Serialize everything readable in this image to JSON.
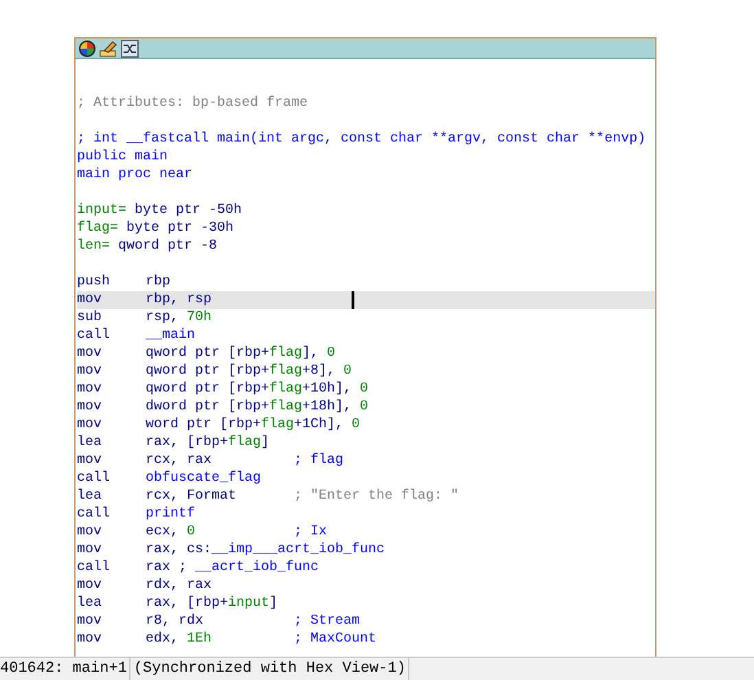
{
  "blocks": [
    [
      {
        "kind": "text",
        "segments": [
          {
            "text": "; Attributes: bp-based frame",
            "kind": "cmt"
          }
        ]
      }
    ],
    [
      {
        "kind": "text",
        "segments": [
          {
            "text": "; int __fastcall main(int argc, const char **argv, const char **envp)",
            "kind": "name"
          }
        ]
      },
      {
        "kind": "text",
        "segments": [
          {
            "text": "public main",
            "kind": "name"
          }
        ]
      },
      {
        "kind": "text",
        "segments": [
          {
            "text": "main proc near",
            "kind": "name"
          }
        ]
      }
    ],
    [
      {
        "kind": "text",
        "segments": [
          {
            "text": "input=",
            "kind": "var"
          },
          {
            "text": " byte ptr -50h",
            "kind": "op"
          }
        ]
      },
      {
        "kind": "text",
        "segments": [
          {
            "text": "flag=",
            "kind": "var"
          },
          {
            "text": " byte ptr -30h",
            "kind": "op"
          }
        ]
      },
      {
        "kind": "text",
        "segments": [
          {
            "text": "len=",
            "kind": "var"
          },
          {
            "text": " qword ptr -8",
            "kind": "op"
          }
        ]
      }
    ],
    [
      {
        "kind": "instruction",
        "mnemonic": "push",
        "selected": false,
        "segments": [
          {
            "text": "rbp",
            "kind": "op"
          }
        ]
      },
      {
        "kind": "instruction",
        "mnemonic": "mov",
        "selected": true,
        "segments": [
          {
            "text": "rbp, rsp",
            "kind": "op"
          }
        ]
      },
      {
        "kind": "instruction",
        "mnemonic": "sub",
        "selected": false,
        "segments": [
          {
            "text": "rsp, ",
            "kind": "op"
          },
          {
            "text": "70h",
            "kind": "num"
          }
        ]
      },
      {
        "kind": "instruction",
        "mnemonic": "call",
        "selected": false,
        "segments": [
          {
            "text": "__main",
            "kind": "name"
          }
        ]
      },
      {
        "kind": "instruction",
        "mnemonic": "mov",
        "selected": false,
        "segments": [
          {
            "text": "qword ptr [rbp+",
            "kind": "op"
          },
          {
            "text": "flag",
            "kind": "var"
          },
          {
            "text": "], ",
            "kind": "op"
          },
          {
            "text": "0",
            "kind": "num"
          }
        ]
      },
      {
        "kind": "instruction",
        "mnemonic": "mov",
        "selected": false,
        "segments": [
          {
            "text": "qword ptr [rbp+",
            "kind": "op"
          },
          {
            "text": "flag",
            "kind": "var"
          },
          {
            "text": "+8], ",
            "kind": "op"
          },
          {
            "text": "0",
            "kind": "num"
          }
        ]
      },
      {
        "kind": "instruction",
        "mnemonic": "mov",
        "selected": false,
        "segments": [
          {
            "text": "qword ptr [rbp+",
            "kind": "op"
          },
          {
            "text": "flag",
            "kind": "var"
          },
          {
            "text": "+10h], ",
            "kind": "op"
          },
          {
            "text": "0",
            "kind": "num"
          }
        ]
      },
      {
        "kind": "instruction",
        "mnemonic": "mov",
        "selected": false,
        "segments": [
          {
            "text": "dword ptr [rbp+",
            "kind": "op"
          },
          {
            "text": "flag",
            "kind": "var"
          },
          {
            "text": "+18h], ",
            "kind": "op"
          },
          {
            "text": "0",
            "kind": "num"
          }
        ]
      },
      {
        "kind": "instruction",
        "mnemonic": "mov",
        "selected": false,
        "segments": [
          {
            "text": "word ptr [rbp+",
            "kind": "op"
          },
          {
            "text": "flag",
            "kind": "var"
          },
          {
            "text": "+1Ch], ",
            "kind": "op"
          },
          {
            "text": "0",
            "kind": "num"
          }
        ]
      },
      {
        "kind": "instruction",
        "mnemonic": "lea",
        "selected": false,
        "segments": [
          {
            "text": "rax, [rbp+",
            "kind": "op"
          },
          {
            "text": "flag",
            "kind": "var"
          },
          {
            "text": "]",
            "kind": "op"
          }
        ]
      },
      {
        "kind": "instruction",
        "mnemonic": "mov",
        "selected": false,
        "segments": [
          {
            "text": "rcx, rax",
            "kind": "op"
          }
        ],
        "comment": {
          "text": "; flag",
          "kind": "name"
        }
      },
      {
        "kind": "instruction",
        "mnemonic": "call",
        "selected": false,
        "segments": [
          {
            "text": "obfuscate_flag",
            "kind": "name"
          }
        ]
      },
      {
        "kind": "instruction",
        "mnemonic": "lea",
        "selected": false,
        "segments": [
          {
            "text": "rcx, Format",
            "kind": "op"
          }
        ],
        "comment": {
          "text": "; \"Enter the flag: \"",
          "kind": "cmt"
        }
      },
      {
        "kind": "instruction",
        "mnemonic": "call",
        "selected": false,
        "segments": [
          {
            "text": "printf",
            "kind": "name"
          }
        ]
      },
      {
        "kind": "instruction",
        "mnemonic": "mov",
        "selected": false,
        "segments": [
          {
            "text": "ecx, ",
            "kind": "op"
          },
          {
            "text": "0",
            "kind": "num"
          }
        ],
        "comment": {
          "text": "; Ix",
          "kind": "name"
        }
      },
      {
        "kind": "instruction",
        "mnemonic": "mov",
        "selected": false,
        "segments": [
          {
            "text": "rax, cs:",
            "kind": "op"
          },
          {
            "text": "__imp___acrt_iob_func",
            "kind": "name"
          }
        ]
      },
      {
        "kind": "instruction",
        "mnemonic": "call",
        "selected": false,
        "segments": [
          {
            "text": "rax ; ",
            "kind": "op"
          },
          {
            "text": "__acrt_iob_func",
            "kind": "name"
          }
        ]
      },
      {
        "kind": "instruction",
        "mnemonic": "mov",
        "selected": false,
        "segments": [
          {
            "text": "rdx, rax",
            "kind": "op"
          }
        ]
      },
      {
        "kind": "instruction",
        "mnemonic": "lea",
        "selected": false,
        "segments": [
          {
            "text": "rax, [rbp+",
            "kind": "op"
          },
          {
            "text": "input",
            "kind": "var"
          },
          {
            "text": "]",
            "kind": "op"
          }
        ]
      },
      {
        "kind": "instruction",
        "mnemonic": "mov",
        "selected": false,
        "segments": [
          {
            "text": "r8, rdx",
            "kind": "op"
          }
        ],
        "comment": {
          "text": "; Stream",
          "kind": "name"
        }
      },
      {
        "kind": "instruction",
        "mnemonic": "mov",
        "selected": false,
        "segments": [
          {
            "text": "edx, ",
            "kind": "op"
          },
          {
            "text": "1Eh",
            "kind": "num"
          }
        ],
        "comment": {
          "text": "; MaxCount",
          "kind": "name"
        }
      }
    ]
  ],
  "status_bar": {
    "address": "401642: main+1",
    "sync": "(Synchronized with Hex View-1)"
  }
}
